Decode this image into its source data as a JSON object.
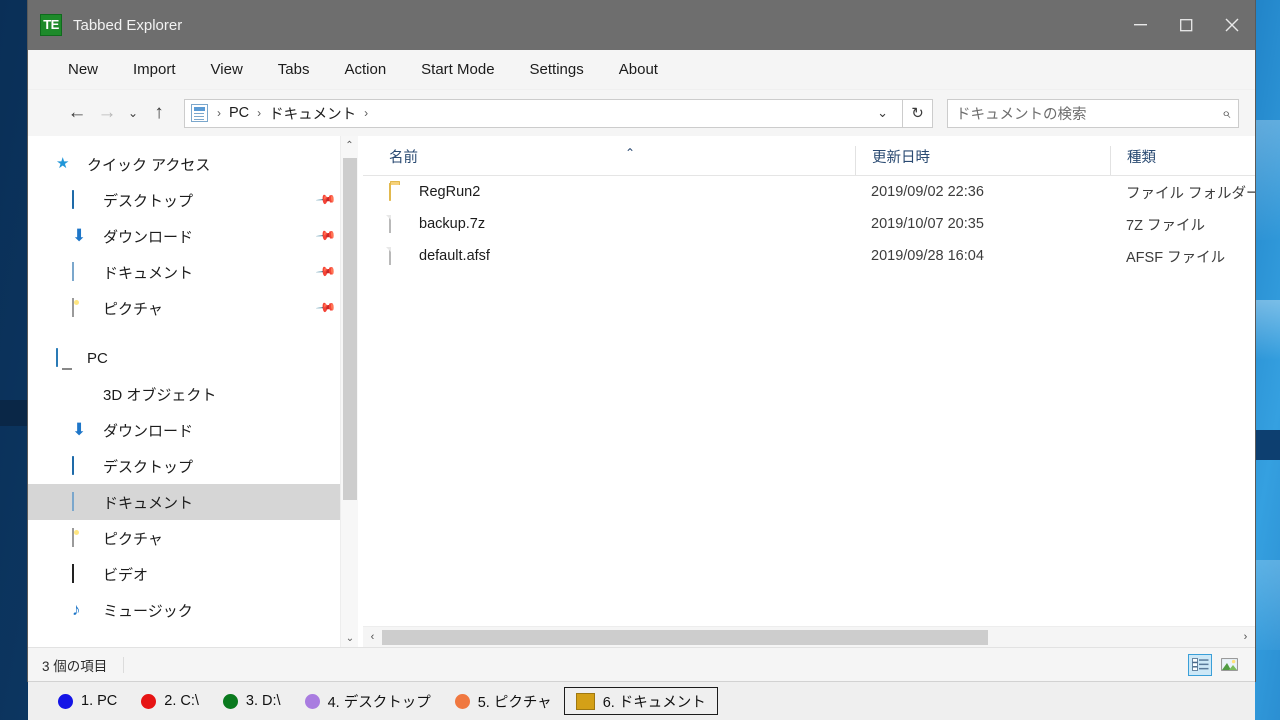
{
  "window": {
    "title": "Tabbed Explorer",
    "app_icon_text": "TE",
    "controls": {
      "minimize": "─",
      "maximize": "□",
      "close": "✕"
    }
  },
  "menubar": {
    "items": [
      {
        "label": "New"
      },
      {
        "label": "Import"
      },
      {
        "label": "View"
      },
      {
        "label": "Tabs"
      },
      {
        "label": "Action"
      },
      {
        "label": "Start Mode"
      },
      {
        "label": "Settings"
      },
      {
        "label": "About"
      }
    ]
  },
  "addressbar": {
    "back_icon": "←",
    "forward_icon": "→",
    "recent_icon": "⌄",
    "up_icon": "↑",
    "breadcrumb": [
      {
        "label": "PC"
      },
      {
        "label": "ドキュメント"
      }
    ],
    "separator": "›",
    "dropdown_icon": "⌄",
    "refresh_icon": "↻",
    "search_placeholder": "ドキュメントの検索",
    "search_icon": "⌕"
  },
  "sidebar": {
    "quick_access": {
      "label": "クイック アクセス",
      "icon": "star-icon",
      "items": [
        {
          "label": "デスクトップ",
          "icon": "desktop-icon",
          "pinned": true
        },
        {
          "label": "ダウンロード",
          "icon": "download-icon",
          "pinned": true
        },
        {
          "label": "ドキュメント",
          "icon": "documents-icon",
          "pinned": true
        },
        {
          "label": "ピクチャ",
          "icon": "pictures-icon",
          "pinned": true
        }
      ]
    },
    "pc": {
      "label": "PC",
      "icon": "pc-icon",
      "items": [
        {
          "label": "3D オブジェクト",
          "icon": "3d-objects-icon",
          "selected": false
        },
        {
          "label": "ダウンロード",
          "icon": "download-icon",
          "selected": false
        },
        {
          "label": "デスクトップ",
          "icon": "desktop-icon",
          "selected": false
        },
        {
          "label": "ドキュメント",
          "icon": "documents-icon",
          "selected": true
        },
        {
          "label": "ピクチャ",
          "icon": "pictures-icon",
          "selected": false
        },
        {
          "label": "ビデオ",
          "icon": "videos-icon",
          "selected": false
        },
        {
          "label": "ミュージック",
          "icon": "music-icon",
          "selected": false
        }
      ]
    },
    "scroll_up_icon": "⌃",
    "scroll_down_icon": "⌄"
  },
  "filelist": {
    "columns": [
      {
        "label": "名前",
        "sorted": true,
        "sort_icon": "⌃"
      },
      {
        "label": "更新日時"
      },
      {
        "label": "種類"
      }
    ],
    "rows": [
      {
        "name": "RegRun2",
        "modified": "2019/09/02 22:36",
        "type": "ファイル フォルダー",
        "icon": "folder-icon"
      },
      {
        "name": "backup.7z",
        "modified": "2019/10/07 20:35",
        "type": "7Z ファイル",
        "icon": "file-icon"
      },
      {
        "name": "default.afsf",
        "modified": "2019/09/28 16:04",
        "type": "AFSF ファイル",
        "icon": "file-icon"
      }
    ],
    "hscroll_left_icon": "‹",
    "hscroll_right_icon": "›"
  },
  "statusbar": {
    "item_count": "3 個の項目",
    "views": [
      {
        "name": "details-view",
        "active": true
      },
      {
        "name": "large-icons-view",
        "active": false
      }
    ]
  },
  "tabs": [
    {
      "label": "1. PC",
      "color": "#1414e6",
      "shape": "dot",
      "active": false
    },
    {
      "label": "2. C:\\",
      "color": "#e61414",
      "shape": "dot",
      "active": false
    },
    {
      "label": "3. D:\\",
      "color": "#0a7a1e",
      "shape": "dot",
      "active": false
    },
    {
      "label": "4. デスクトップ",
      "color": "#a97ce0",
      "shape": "dot",
      "active": false
    },
    {
      "label": "5. ピクチャ",
      "color": "#f07840",
      "shape": "dot",
      "active": false
    },
    {
      "label": "6. ドキュメント",
      "color": "#d4a017",
      "shape": "square",
      "active": true
    }
  ]
}
